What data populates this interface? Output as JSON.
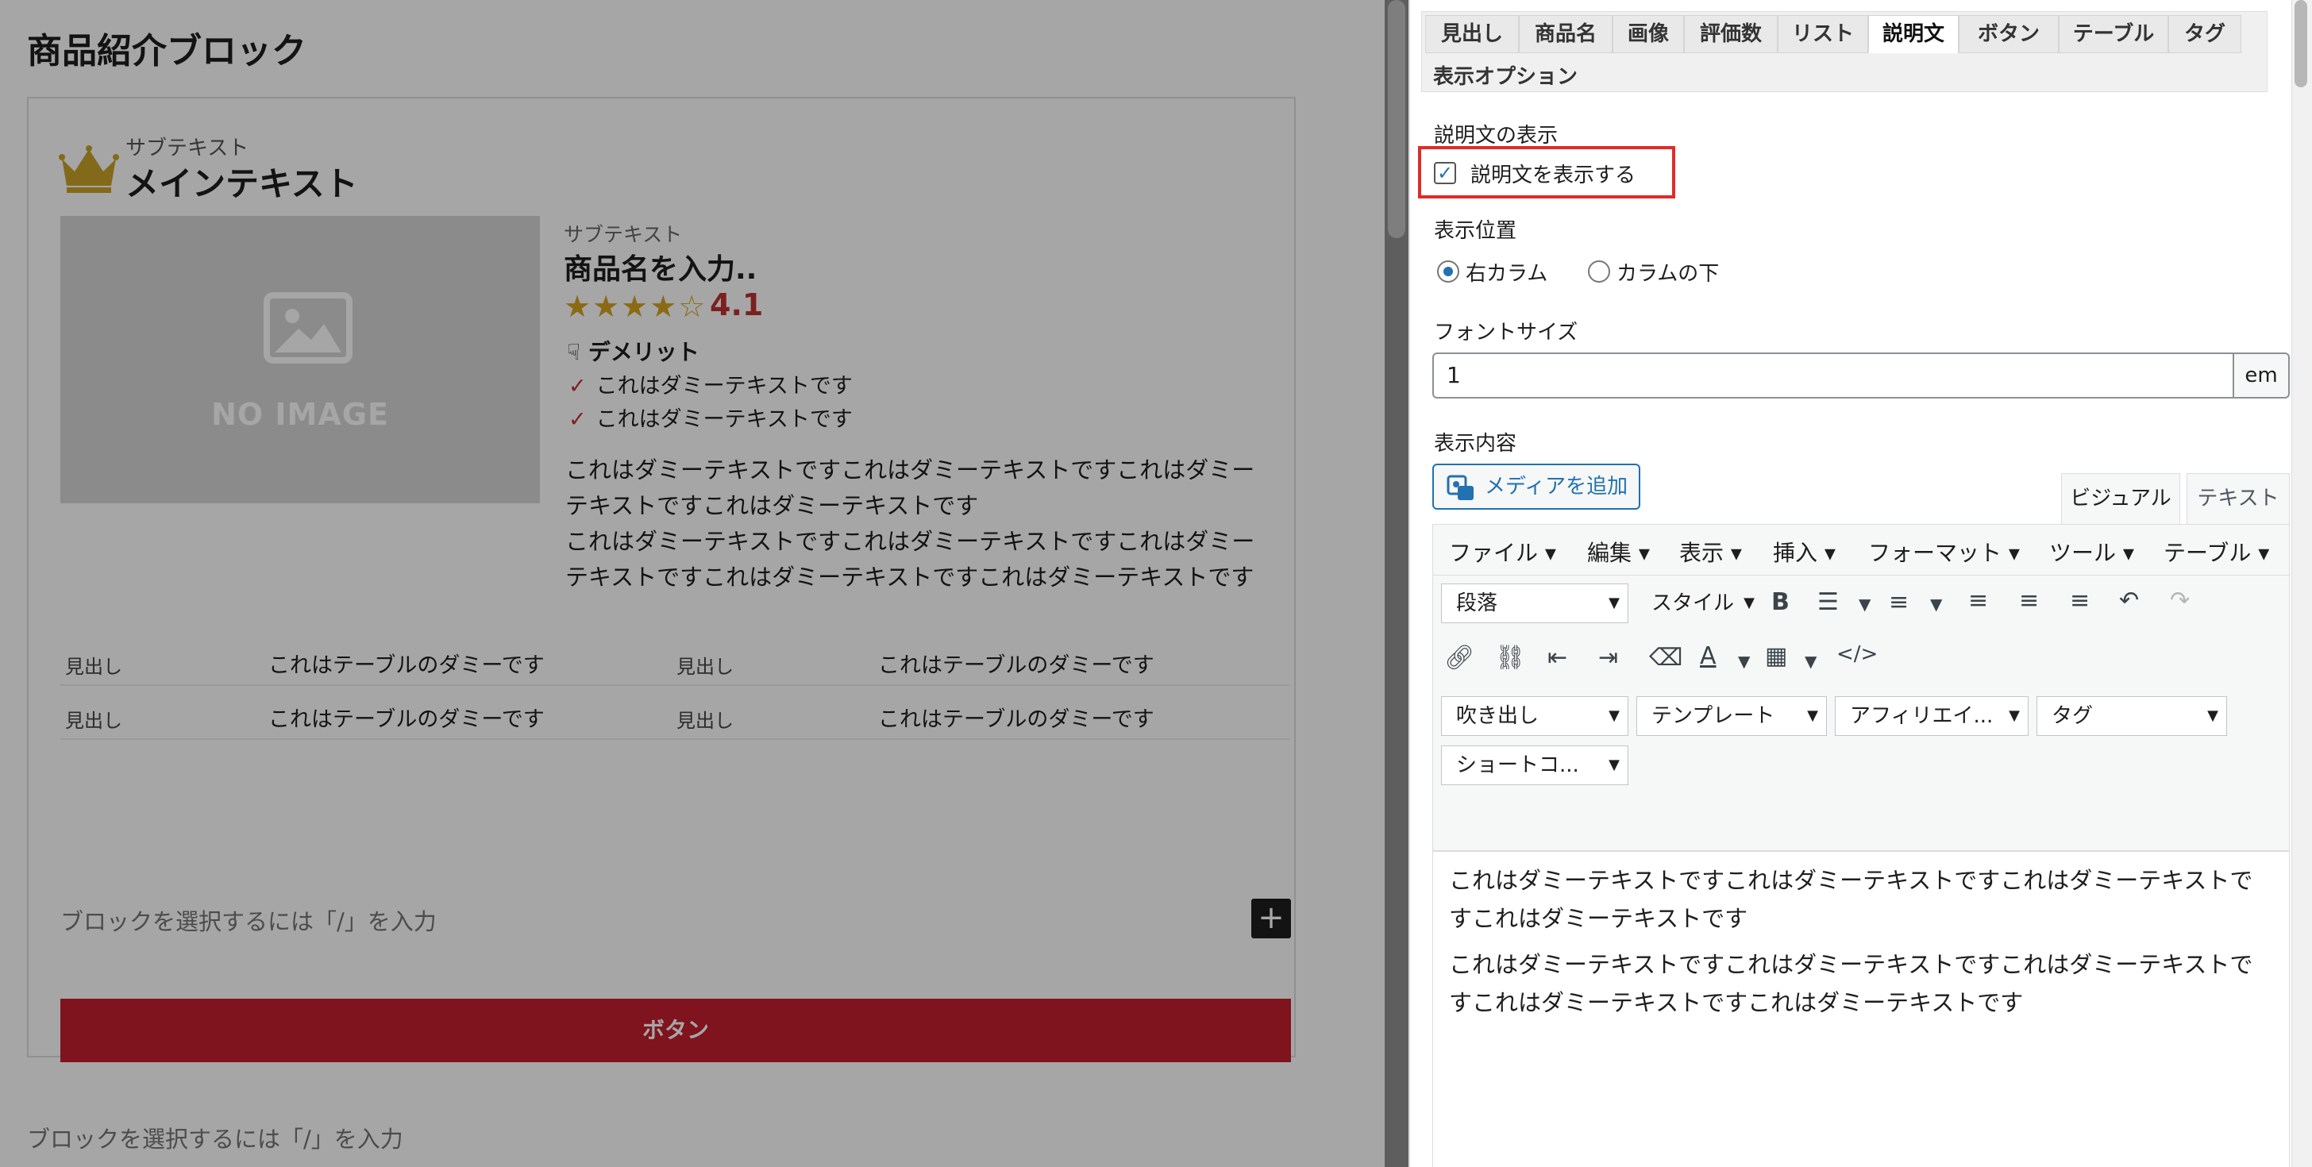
{
  "editor": {
    "page_title": "商品紹介ブロック",
    "heading": {
      "sub": "サブテキスト",
      "main": "メインテキスト"
    },
    "image_placeholder": "NO IMAGE",
    "product": {
      "sub": "サブテキスト",
      "name": "商品名を入力..",
      "stars": "★★★★☆",
      "rating": "4.1"
    },
    "demerit": {
      "title": "デメリット",
      "items": [
        "これはダミーテキストです",
        "これはダミーテキストです"
      ]
    },
    "description": {
      "p1": "これはダミーテキストですこれはダミーテキストですこれはダミーテキストですこれはダミーテキストです",
      "p2": "これはダミーテキストですこれはダミーテキストですこれはダミーテキストですこれはダミーテキストですこれはダミーテキストです"
    },
    "spec_table": [
      {
        "k1": "見出し",
        "v1": "これはテーブルのダミーです",
        "k2": "見出し",
        "v2": "これはテーブルのダミーです"
      },
      {
        "k1": "見出し",
        "v1": "これはテーブルのダミーです",
        "k2": "見出し",
        "v2": "これはテーブルのダミーです"
      }
    ],
    "inner_placeholder": "ブロックを選択するには「/」を入力",
    "button_label": "ボタン",
    "outer_placeholder": "ブロックを選択するには「/」を入力",
    "button_color": "#c4202e"
  },
  "panel": {
    "tabs": [
      "見出し",
      "商品名",
      "画像",
      "評価数",
      "リスト",
      "説明文",
      "ボタン",
      "テーブル",
      "タグ"
    ],
    "tab_row2": "表示オプション",
    "active_tab": "説明文",
    "show_section_label": "説明文の表示",
    "show_checkbox_label": "説明文を表示する",
    "show_checked": true,
    "position_label": "表示位置",
    "position_options": [
      "右カラム",
      "カラムの下"
    ],
    "position_selected": "右カラム",
    "font_size_label": "フォントサイズ",
    "font_size_value": "1",
    "font_size_unit": "em",
    "content_label": "表示内容",
    "add_media": "メディアを追加",
    "editor_tabs": {
      "visual": "ビジュアル",
      "text": "テキスト"
    },
    "menubar": [
      "ファイル",
      "編集",
      "表示",
      "挿入",
      "フォーマット",
      "ツール",
      "テーブル"
    ],
    "paragraph_select": "段落",
    "style_select": "スタイル",
    "dropdowns": [
      "吹き出し",
      "テンプレート",
      "アフィリエイ...",
      "タグ",
      "ショートコ..."
    ],
    "content": {
      "p1": "これはダミーテキストですこれはダミーテキストですこれはダミーテキストですこれはダミーテキストです",
      "p2": "これはダミーテキストですこれはダミーテキストですこれはダミーテキストですこれはダミーテキストですこれはダミーテキストです"
    },
    "highlight_color": "#e02b2b",
    "accent_color": "#2271b1"
  }
}
